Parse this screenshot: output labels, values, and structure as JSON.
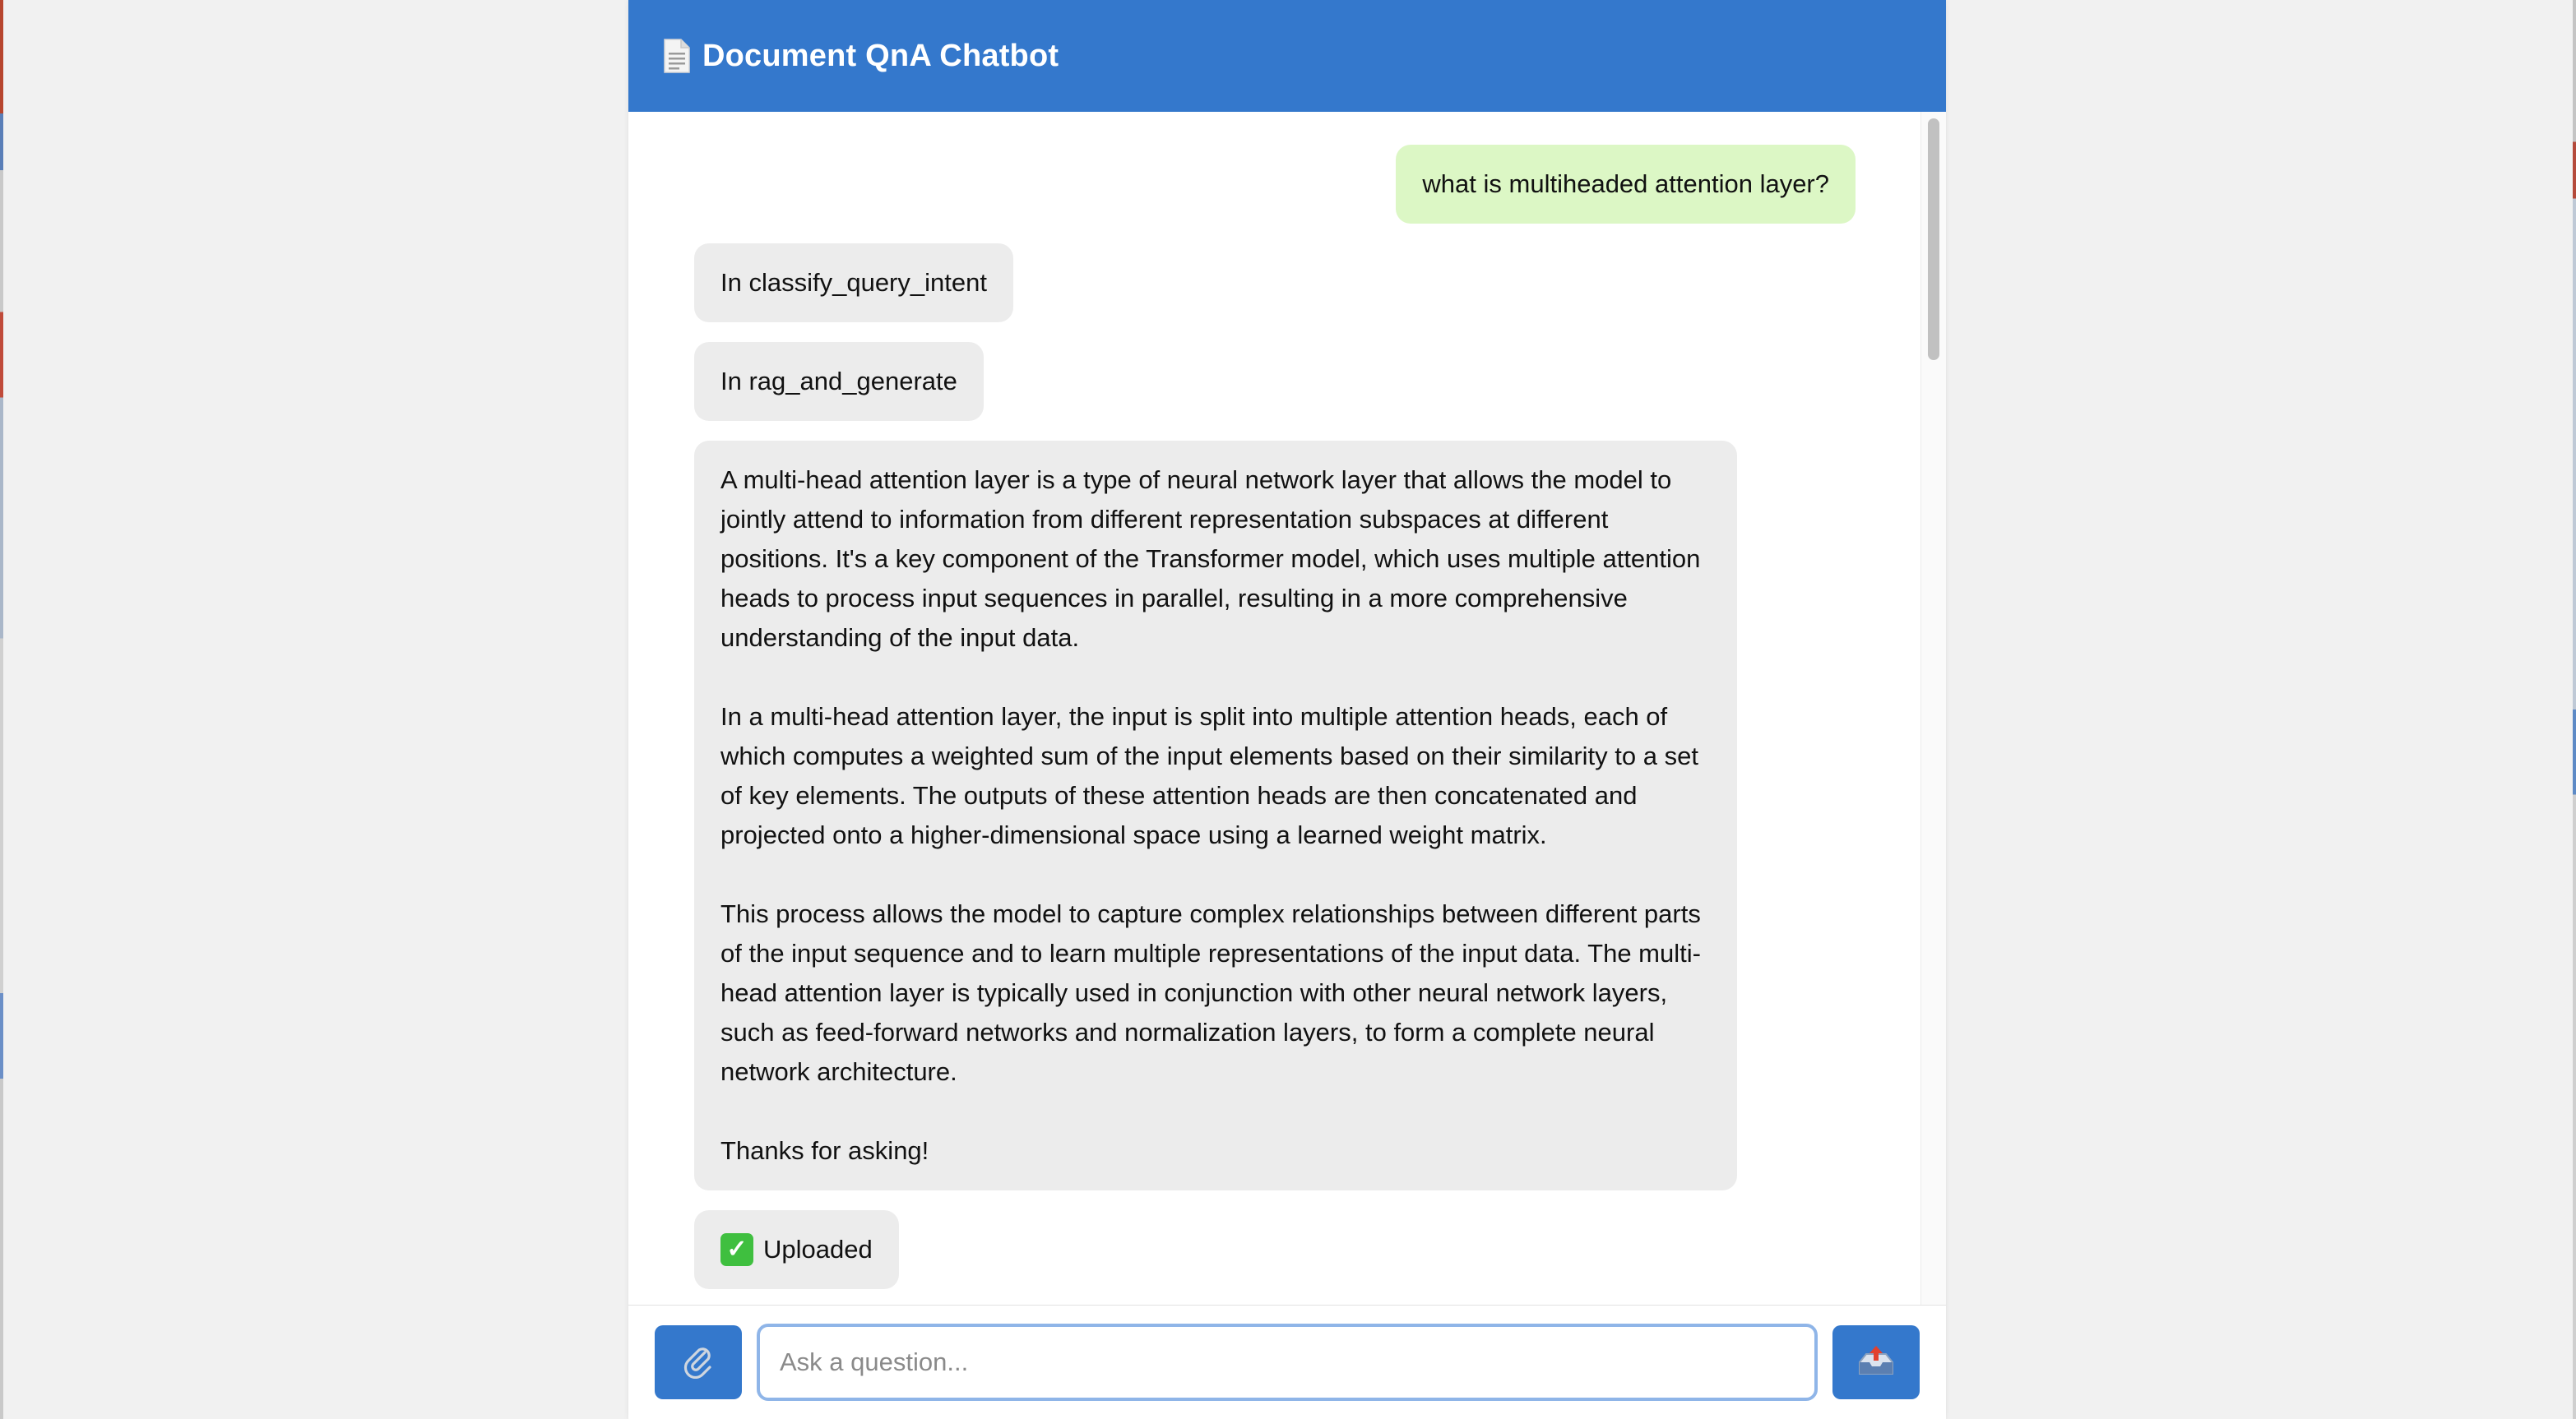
{
  "header": {
    "title": "Document QnA Chatbot",
    "icon": "document-icon"
  },
  "messages": [
    {
      "role": "user",
      "text": "what is multiheaded attention layer?"
    },
    {
      "role": "bot",
      "text": "In classify_query_intent"
    },
    {
      "role": "bot",
      "text": "In rag_and_generate"
    },
    {
      "role": "bot",
      "paragraphs": [
        "A multi-head attention layer is a type of neural network layer that allows the model to jointly attend to information from different representation subspaces at different positions. It's a key component of the Transformer model, which uses multiple attention heads to process input sequences in parallel, resulting in a more comprehensive understanding of the input data.",
        "In a multi-head attention layer, the input is split into multiple attention heads, each of which computes a weighted sum of the input elements based on their similarity to a set of key elements. The outputs of these attention heads are then concatenated and projected onto a higher-dimensional space using a learned weight matrix.",
        "This process allows the model to capture complex relationships between different parts of the input sequence and to learn multiple representations of the input data. The multi-head attention layer is typically used in conjunction with other neural network layers, such as feed-forward networks and normalization layers, to form a complete neural network architecture.",
        "Thanks for asking!"
      ]
    },
    {
      "role": "bot",
      "text": "Uploaded",
      "icon": "check-mark-icon"
    }
  ],
  "input": {
    "placeholder": "Ask a question...",
    "value": ""
  },
  "buttons": {
    "attach_icon": "paperclip-icon",
    "send_icon": "outbox-tray-icon"
  },
  "colors": {
    "header": "#3478cc",
    "user_bubble": "#dcf7c5",
    "bot_bubble": "#ececec",
    "button": "#3478cc"
  }
}
